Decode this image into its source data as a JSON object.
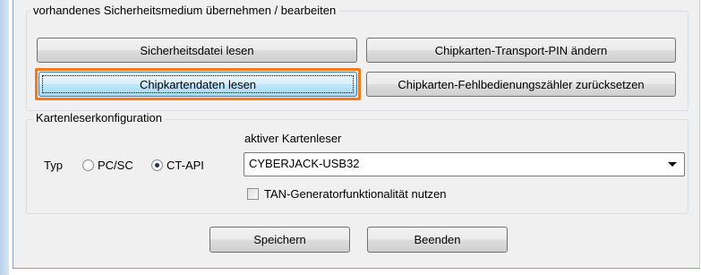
{
  "group_existing": {
    "legend": "vorhandenes Sicherheitsmedium übernehmen / bearbeiten",
    "buttons": {
      "read_security_file": "Sicherheitsdatei lesen",
      "change_transport_pin": "Chipkarten-Transport-PIN ändern",
      "read_chipcard_data": "Chipkartendaten lesen",
      "reset_error_counter": "Chipkarten-Fehlbedienungszähler zurücksetzen"
    }
  },
  "group_reader": {
    "legend": "Kartenleserkonfiguration",
    "type_label": "Typ",
    "radio_pcsc": "PC/SC",
    "radio_ctapi": "CT-API",
    "selected_type": "CT-API",
    "active_reader_label": "aktiver Kartenleser",
    "active_reader_value": "CYBERJACK-USB32",
    "tan_checkbox_label": "TAN-Generatorfunktionalität nutzen",
    "tan_checked": false
  },
  "footer": {
    "save": "Speichern",
    "quit": "Beenden"
  },
  "colors": {
    "focus_ring": "#f07a1e",
    "window_bg": "#f0f0f0",
    "focused_button": "#bee6fd"
  }
}
